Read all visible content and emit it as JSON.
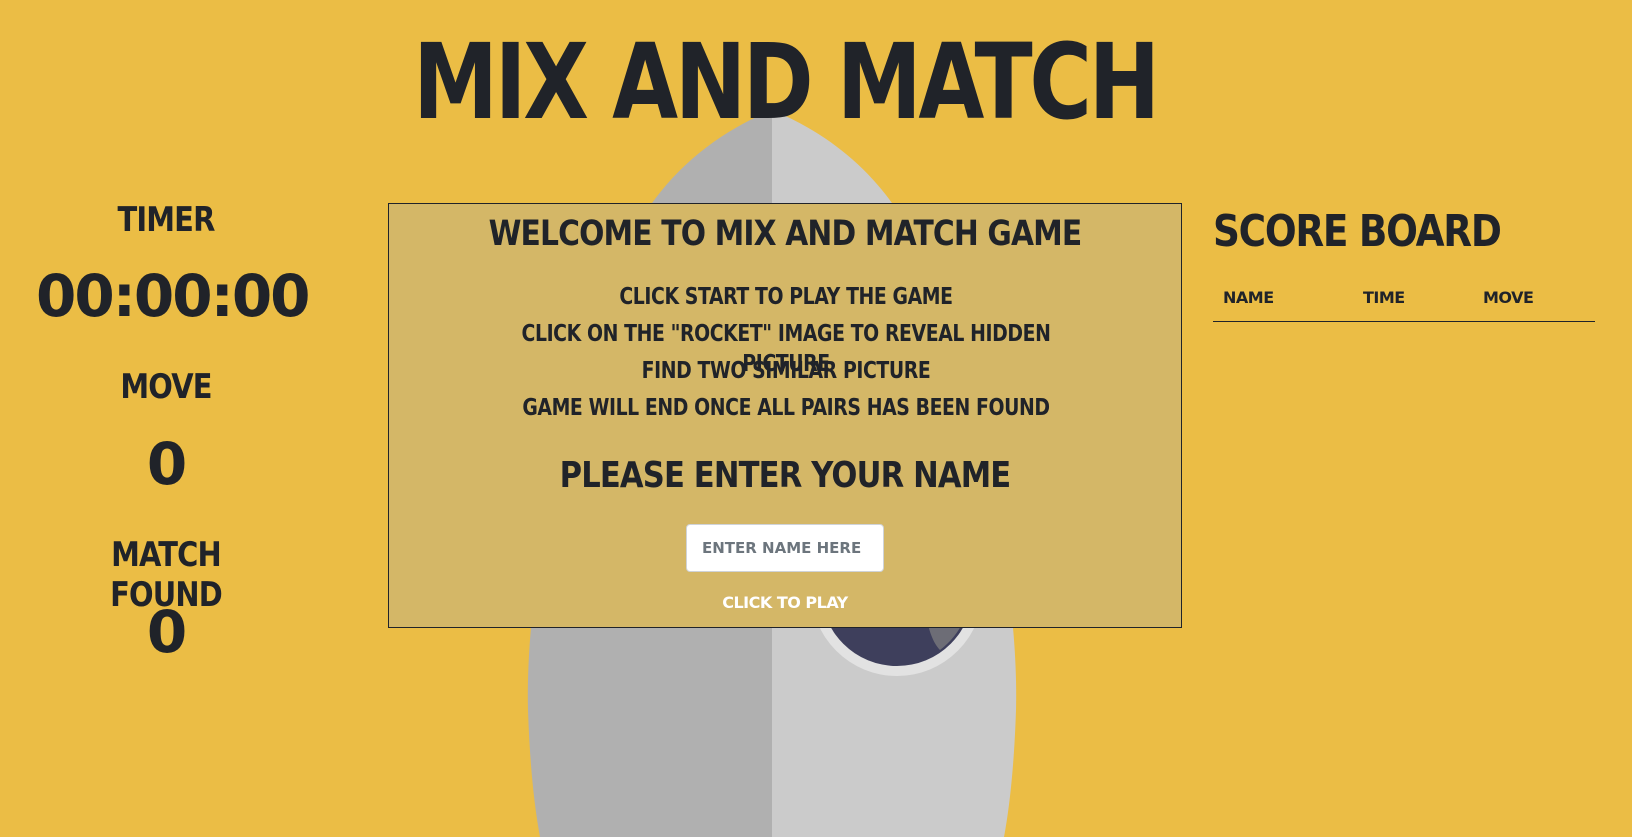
{
  "title": "MIX AND MATCH",
  "stats": {
    "timer_label": "TIMER",
    "timer_value": "00:00:00",
    "move_label": "MOVE",
    "move_value": "0",
    "match_label": "MATCH FOUND",
    "match_value": "0"
  },
  "modal": {
    "title": "WELCOME TO MIX AND MATCH GAME",
    "instructions": [
      "CLICK START TO PLAY THE GAME",
      "CLICK ON THE \"ROCKET\" IMAGE TO REVEAL HIDDEN PICTURE",
      "FIND TWO SIMILAR PICTURE",
      "GAME WILL END ONCE ALL PAIRS HAS BEEN FOUND"
    ],
    "name_prompt": "PLEASE ENTER YOUR NAME",
    "name_placeholder": "ENTER NAME HERE",
    "name_value": "",
    "play_label": "CLICK TO PLAY"
  },
  "scoreboard": {
    "title": "SCORE BOARD",
    "columns": [
      "NAME",
      "TIME",
      "MOVE"
    ]
  },
  "colors": {
    "background": "#ebbd45",
    "modal_background": "#d4b767",
    "text": "#202329",
    "rocket_light": "#cbcbcb",
    "rocket_dark": "#b0b0b0",
    "window": "#3e3f5c"
  },
  "icons": {
    "background_image": "rocket-icon"
  }
}
